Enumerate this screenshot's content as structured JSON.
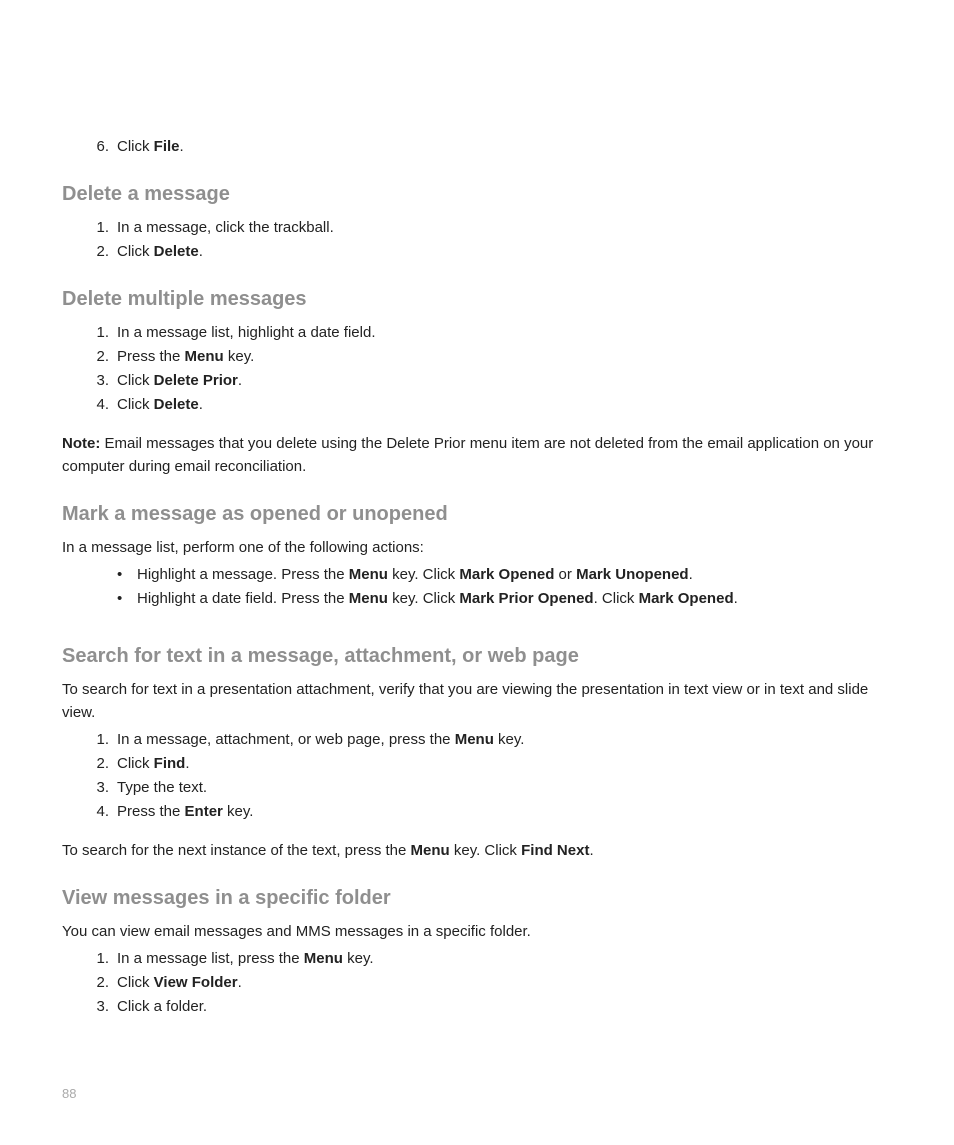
{
  "step6": {
    "pre": "Click ",
    "bold": "File",
    "post": "."
  },
  "s1": {
    "heading": "Delete a message",
    "steps": [
      {
        "pre": "In a message, click the trackball."
      },
      {
        "pre": "Click ",
        "bold": "Delete",
        "post": "."
      }
    ]
  },
  "s2": {
    "heading": "Delete multiple messages",
    "steps": [
      {
        "pre": "In a message list, highlight a date field."
      },
      {
        "pre": "Press the ",
        "bold": "Menu",
        "post": " key."
      },
      {
        "pre": "Click ",
        "bold": "Delete Prior",
        "post": "."
      },
      {
        "pre": "Click ",
        "bold": "Delete",
        "post": "."
      }
    ],
    "note_label": "Note:",
    "note_body": " Email messages that you delete using the Delete Prior menu item are not deleted from the email application on your computer during email reconciliation."
  },
  "s3": {
    "heading": "Mark a message as opened or unopened",
    "intro": "In a message list, perform one of the following actions:",
    "b1": {
      "a": "Highlight a message. Press the ",
      "b": "Menu",
      "c": " key. Click ",
      "d": "Mark Opened",
      "e": " or ",
      "f": "Mark Unopened",
      "g": "."
    },
    "b2": {
      "a": "Highlight a date field. Press the ",
      "b": "Menu",
      "c": " key. Click ",
      "d": "Mark Prior Opened",
      "e": ". Click ",
      "f": "Mark Opened",
      "g": "."
    }
  },
  "s4": {
    "heading": "Search for text in a message, attachment, or web page",
    "intro": "To search for text in a presentation attachment, verify that you are viewing the presentation in text view or in text and slide view.",
    "steps": [
      {
        "pre": "In a message, attachment, or web page, press the ",
        "bold": "Menu",
        "post": " key."
      },
      {
        "pre": "Click ",
        "bold": "Find",
        "post": "."
      },
      {
        "pre": "Type the text."
      },
      {
        "pre": "Press the ",
        "bold": "Enter",
        "post": " key."
      }
    ],
    "out": {
      "a": "To search for the next instance of the text, press the ",
      "b": "Menu",
      "c": " key. Click ",
      "d": "Find Next",
      "e": "."
    }
  },
  "s5": {
    "heading": "View messages in a specific folder",
    "intro": "You can view email messages and MMS messages in a specific folder.",
    "steps": [
      {
        "pre": "In a message list, press the ",
        "bold": "Menu",
        "post": " key."
      },
      {
        "pre": "Click ",
        "bold": "View Folder",
        "post": "."
      },
      {
        "pre": "Click a folder."
      }
    ]
  },
  "page_number": "88"
}
